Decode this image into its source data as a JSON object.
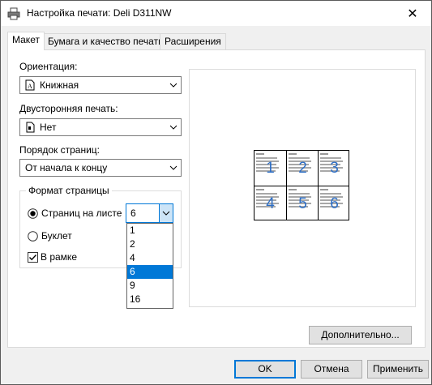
{
  "window": {
    "title": "Настройка печати: Deli D311NW",
    "close_glyph": "✕"
  },
  "tabs": [
    {
      "label": "Макет",
      "active": true
    },
    {
      "label": "Бумага и качество печати",
      "active": false
    },
    {
      "label": "Расширения",
      "active": false
    }
  ],
  "layout": {
    "orientation_label": "Ориентация:",
    "orientation_value": "Книжная",
    "duplex_label": "Двусторонняя печать:",
    "duplex_value": "Нет",
    "page_order_label": "Порядок страниц:",
    "page_order_value": "От начала к концу",
    "page_format_group": "Формат страницы",
    "pages_per_sheet_label": "Страниц на листе",
    "pages_per_sheet_value": "6",
    "pages_per_sheet_checked": true,
    "booklet_label": "Буклет",
    "booklet_checked": false,
    "border_label": "В рамке",
    "border_checked": true,
    "pages_per_sheet_options": [
      "1",
      "2",
      "4",
      "6",
      "9",
      "16"
    ],
    "pages_per_sheet_selected_index": 3,
    "advanced_button": "Дополнительно..."
  },
  "preview": {
    "page_numbers": [
      "1",
      "2",
      "3",
      "4",
      "5",
      "6"
    ]
  },
  "footer": {
    "ok": "OK",
    "cancel": "Отмена",
    "apply": "Применить"
  },
  "colors": {
    "accent": "#0078d7",
    "page_number": "#2e6fc6"
  }
}
